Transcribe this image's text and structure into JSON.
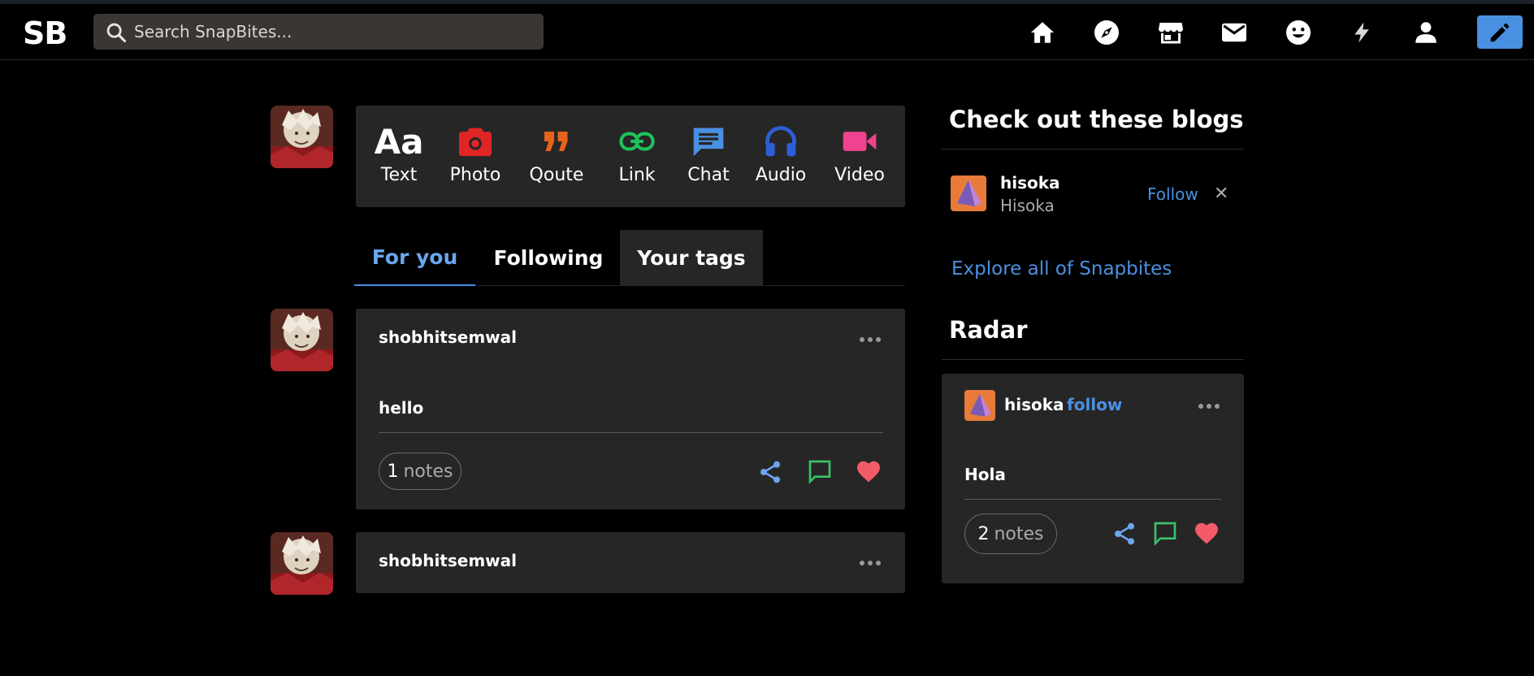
{
  "header": {
    "logo": "SB",
    "search_placeholder": "Search SnapBites...",
    "nav_icons": [
      "home-icon",
      "explore-compass-icon",
      "store-icon",
      "mail-icon",
      "emoji-icon",
      "activity-bolt-icon",
      "account-icon"
    ],
    "edit_icon": "pencil-icon"
  },
  "composer": {
    "types": [
      {
        "label": "Text",
        "glyph": "Aa",
        "icon": "text-icon",
        "color": "#ffffff"
      },
      {
        "label": "Photo",
        "icon": "camera-icon",
        "color": "#e02525"
      },
      {
        "label": "Qoute",
        "icon": "quote-icon",
        "color": "#e8631a"
      },
      {
        "label": "Link",
        "icon": "link-icon",
        "color": "#1ec35a"
      },
      {
        "label": "Chat",
        "icon": "chat-icon",
        "color": "#4a90e2"
      },
      {
        "label": "Audio",
        "icon": "headphones-icon",
        "color": "#2c5fd6"
      },
      {
        "label": "Video",
        "icon": "video-icon",
        "color": "#f0438f"
      }
    ]
  },
  "tabs": [
    {
      "label": "For you"
    },
    {
      "label": "Following"
    },
    {
      "label": "Your tags"
    }
  ],
  "posts": [
    {
      "author": "shobhitsemwal",
      "body": "hello",
      "notes_count": "1",
      "notes_word": "notes"
    },
    {
      "author": "shobhitsemwal"
    }
  ],
  "sidebar": {
    "blogs_title": "Check out these blogs",
    "blog": {
      "name": "hisoka",
      "subtitle": "Hisoka",
      "follow_label": "Follow",
      "dismiss": "✕"
    },
    "explore_label": "Explore all of Snapbites",
    "radar_title": "Radar",
    "radar_post": {
      "name": "hisoka",
      "follow_label": "follow",
      "body": "Hola",
      "notes_count": "2",
      "notes_word": "notes"
    }
  },
  "colors": {
    "accent": "#4a90e2",
    "card_bg": "#262626",
    "share": "#6ba6ef",
    "reply": "#3ac26a",
    "like": "#f25b67"
  }
}
